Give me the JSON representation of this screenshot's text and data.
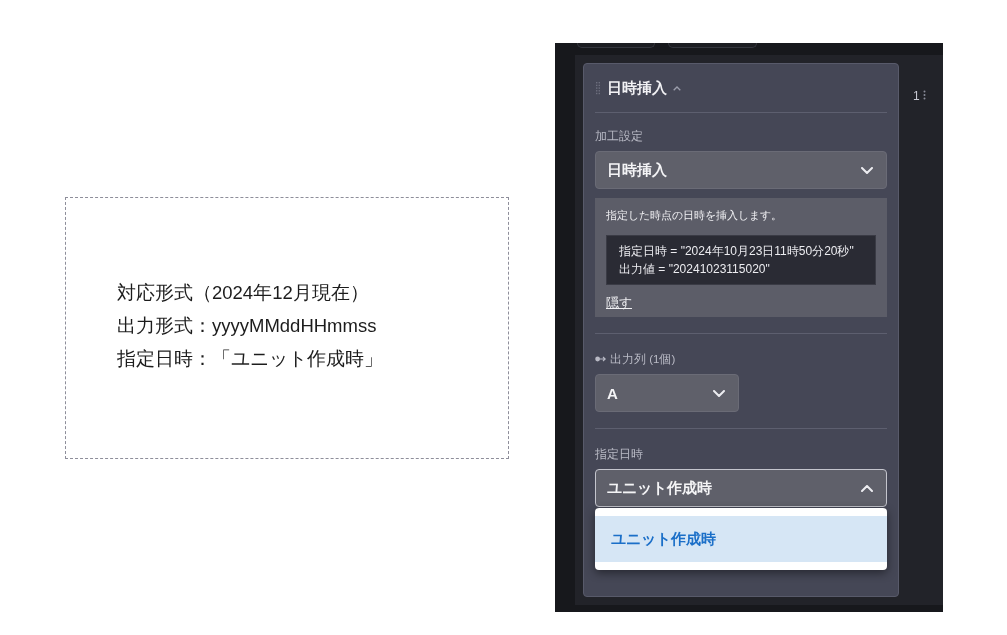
{
  "note": {
    "lines": [
      "対応形式（2024年12月現在）",
      "出力形式：yyyyMMddHHmmss",
      "指定日時：「ユニット作成時」"
    ]
  },
  "editor": {
    "step": {
      "title": "日時挿入",
      "expanded": true,
      "process_setting": {
        "label": "加工設定",
        "value": "日時挿入",
        "open": false
      },
      "help": {
        "text": "指定した時点の日時を挿入します。",
        "example_lines": [
          "指定日時 = \"2024年10月23日11時50分20秒\"",
          "出力値 = \"20241023115020\""
        ],
        "hide_link": "隠す"
      },
      "output_column": {
        "label": "出力列 (1個)",
        "value": "A",
        "open": false
      },
      "specified_datetime": {
        "label": "指定日時",
        "value": "ユニット作成時",
        "open": true,
        "options": [
          {
            "label": "ユニット作成時",
            "selected": true
          }
        ]
      }
    },
    "step_number": "1"
  }
}
